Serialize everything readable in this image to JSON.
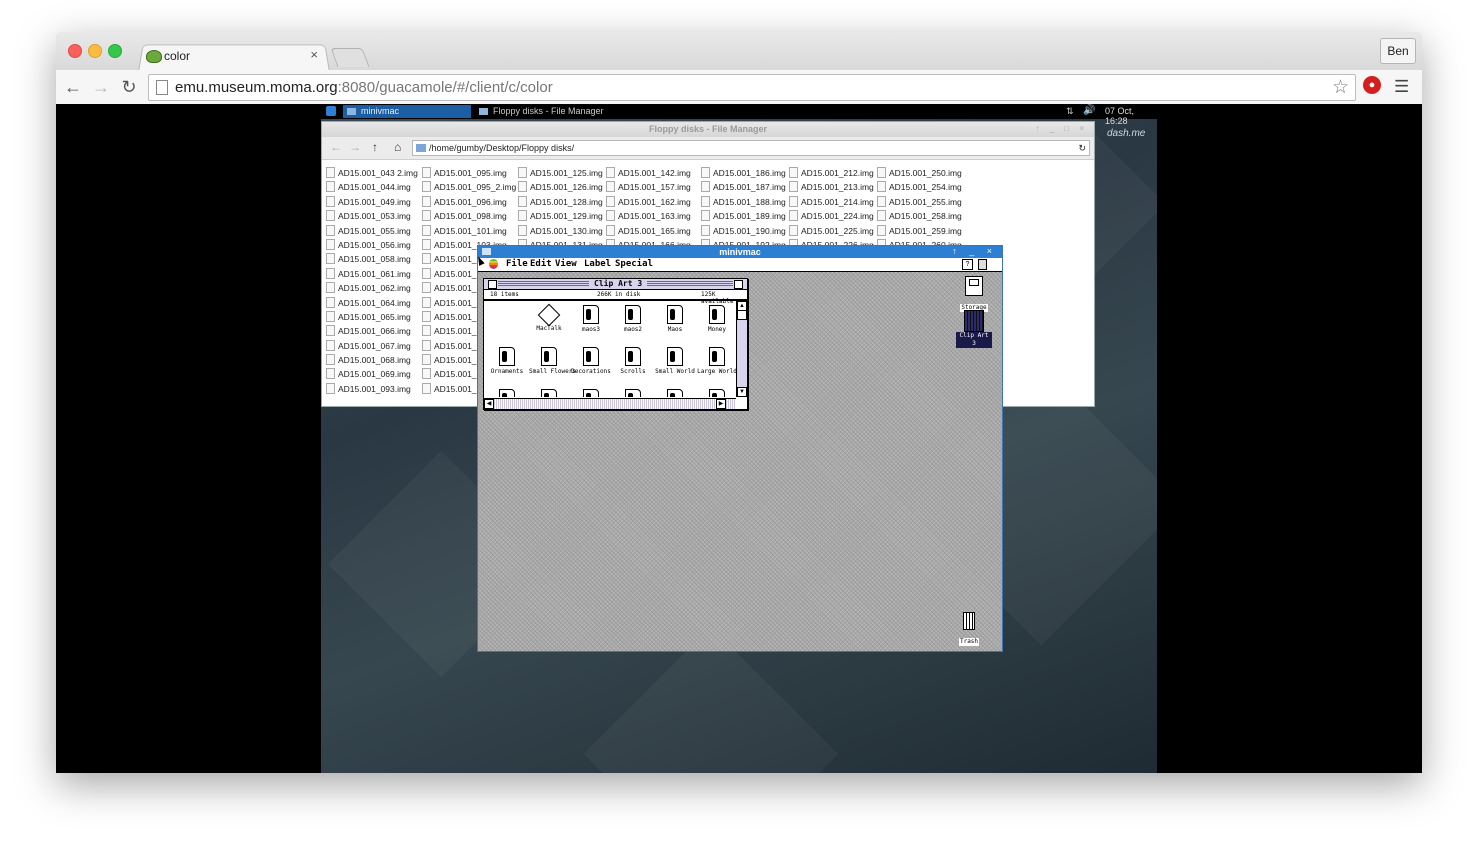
{
  "browser": {
    "tab_title": "color",
    "tab_close": "×",
    "profile": "Ben",
    "url_host": "emu.museum.moma.org",
    "url_path": ":8080/guacamole/#/client/c/color",
    "icons": [
      "back-arrow-icon",
      "forward-arrow-icon",
      "reload-icon",
      "page-icon",
      "star-icon",
      "adblock-icon",
      "menu-icon"
    ]
  },
  "remote": {
    "taskbar": {
      "task1": "minivmac",
      "task2": "Floppy disks - File Manager",
      "clock": "07 Oct, 16:28"
    },
    "desktop_label": "dash.me",
    "file_manager": {
      "title": "Floppy disks - File Manager",
      "path": "/home/gumby/Desktop/Floppy disks/",
      "columns": [
        [
          "AD15.001_043 2.img",
          "AD15.001_044.img",
          "AD15.001_049.img",
          "AD15.001_053.img",
          "AD15.001_055.img",
          "AD15.001_056.img",
          "AD15.001_058.img",
          "AD15.001_061.img",
          "AD15.001_062.img",
          "AD15.001_064.img",
          "AD15.001_065.img",
          "AD15.001_066.img",
          "AD15.001_067.img",
          "AD15.001_068.img",
          "AD15.001_069.img",
          "AD15.001_093.img"
        ],
        [
          "AD15.001_095.img",
          "AD15.001_095_2.img",
          "AD15.001_096.img",
          "AD15.001_098.img",
          "AD15.001_101.img",
          "AD15.001_103.img",
          "AD15.001_1",
          "AD15.001_1",
          "AD15.001_1",
          "AD15.001_1",
          "AD15.001_1",
          "AD15.001_1",
          "AD15.001_1",
          "AD15.001_1",
          "AD15.001_1",
          "AD15.001_1"
        ],
        [
          "AD15.001_125.img",
          "AD15.001_126.img",
          "AD15.001_128.img",
          "AD15.001_129.img",
          "AD15.001_130.img",
          "AD15.001_131.img"
        ],
        [
          "AD15.001_142.img",
          "AD15.001_157.img",
          "AD15.001_162.img",
          "AD15.001_163.img",
          "AD15.001_165.img",
          "AD15.001_166.img"
        ],
        [
          "AD15.001_186.img",
          "AD15.001_187.img",
          "AD15.001_188.img",
          "AD15.001_189.img",
          "AD15.001_190.img",
          "AD15.001_192.img"
        ],
        [
          "AD15.001_212.img",
          "AD15.001_213.img",
          "AD15.001_214.img",
          "AD15.001_224.img",
          "AD15.001_225.img",
          "AD15.001_226.img"
        ],
        [
          "AD15.001_250.img",
          "AD15.001_254.img",
          "AD15.001_255.img",
          "AD15.001_258.img",
          "AD15.001_259.img",
          "AD15.001_260.img"
        ]
      ]
    },
    "minivmac": {
      "title": "minivmac",
      "menus": [
        "File",
        "Edit",
        "View",
        "Label",
        "Special"
      ],
      "help": "?",
      "window": {
        "title": "Clip Art 3",
        "items": "18 items",
        "disk": "266K in disk",
        "available": "125K available",
        "icons": [
          {
            "label": "MacTalk",
            "kind": "app"
          },
          {
            "label": "maos3",
            "kind": "doc"
          },
          {
            "label": "maos2",
            "kind": "doc"
          },
          {
            "label": "Maos",
            "kind": "doc"
          },
          {
            "label": "Money",
            "kind": "doc"
          },
          {
            "label": "Ornaments",
            "kind": "doc"
          },
          {
            "label": "Small Flowers",
            "kind": "doc"
          },
          {
            "label": "Decorations",
            "kind": "doc"
          },
          {
            "label": "Scrolls",
            "kind": "doc"
          },
          {
            "label": "Small World",
            "kind": "doc"
          },
          {
            "label": "Large World",
            "kind": "doc"
          }
        ]
      },
      "desktop": {
        "storage": "Storage",
        "clipart": "Clip Art 3",
        "trash": "Trash"
      }
    }
  }
}
